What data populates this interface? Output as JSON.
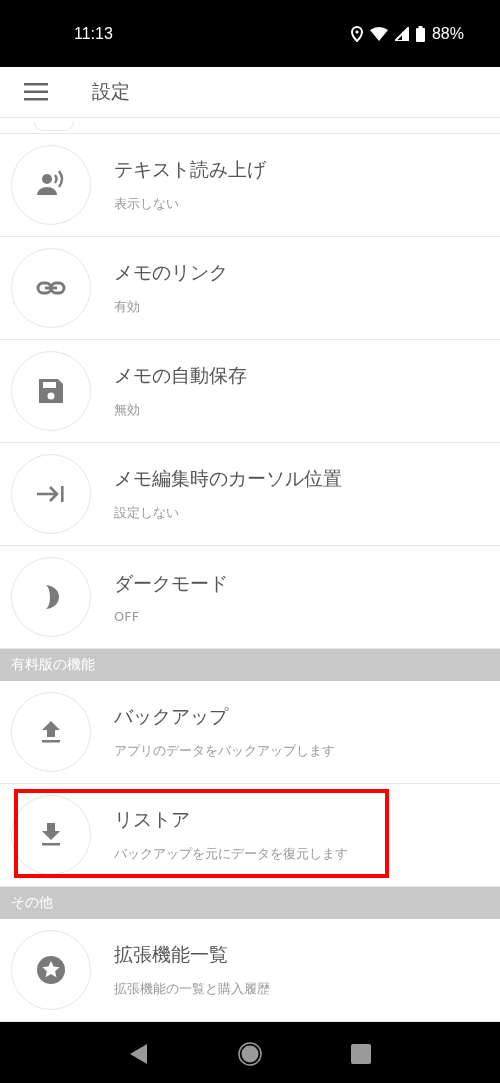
{
  "status_bar": {
    "time": "11:13",
    "battery": "88%"
  },
  "app_bar": {
    "title": "設定"
  },
  "sections": [
    {
      "items": [
        {
          "kind": "speaker",
          "title": "テキスト読み上げ",
          "subtitle": "表示しない",
          "highlighted": false
        },
        {
          "kind": "link",
          "title": "メモのリンク",
          "subtitle": "有効",
          "highlighted": false
        },
        {
          "kind": "save",
          "title": "メモの自動保存",
          "subtitle": "無効",
          "highlighted": false
        },
        {
          "kind": "arrow-bar",
          "title": "メモ編集時のカーソル位置",
          "subtitle": "設定しない",
          "highlighted": false
        },
        {
          "kind": "moon",
          "title": "ダークモード",
          "subtitle": "OFF",
          "highlighted": false
        }
      ]
    },
    {
      "header": "有料版の機能",
      "items": [
        {
          "kind": "upload",
          "title": "バックアップ",
          "subtitle": "アプリのデータをバックアップします",
          "highlighted": false
        },
        {
          "kind": "download",
          "title": "リストア",
          "subtitle": "バックアップを元にデータを復元します",
          "highlighted": true
        }
      ]
    },
    {
      "header": "その他",
      "items": [
        {
          "kind": "star",
          "title": "拡張機能一覧",
          "subtitle": "拡張機能の一覧と購入履歴",
          "highlighted": false
        }
      ]
    }
  ]
}
